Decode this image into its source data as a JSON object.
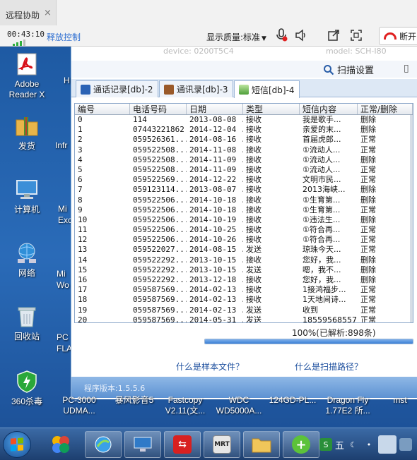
{
  "remote": {
    "title": "远程协助",
    "close_glyph": "×",
    "elapsed": "00:43:10",
    "release_control": "释放控制",
    "display_quality": "显示质量:标准",
    "disconnect": "断开"
  },
  "desktop": {
    "icons": [
      {
        "label": "Adobe Reader X",
        "icon": "pdf-icon"
      },
      {
        "label": "发货",
        "icon": "folder-icon"
      },
      {
        "label": "计算机",
        "icon": "computer-icon"
      },
      {
        "label": "网络",
        "icon": "network-icon"
      },
      {
        "label": "回收站",
        "icon": "recycle-bin-icon"
      },
      {
        "label": "360杀毒",
        "icon": "shield-icon"
      }
    ],
    "side_labels": [
      "H",
      "Infr",
      "Mi Exc",
      "Mi Wo",
      "PC FLA"
    ],
    "bottom_labels": [
      "PC-3000 UDMA...",
      "暴风影音5",
      "Fastcopy V2.11(文...",
      "WDC WD5000A...",
      "124GD-PL...",
      "Dragon Fly 1.77E2 所...",
      "mst"
    ]
  },
  "app": {
    "ghost_left": "device: 0200T5C4",
    "ghost_right": "model: SCH-I80",
    "scan_settings": "扫描设置",
    "tabs": [
      {
        "label": "通话记录[db]-2",
        "icon": "phone-icon"
      },
      {
        "label": "通讯录[db]-3",
        "icon": "contacts-icon"
      },
      {
        "label": "短信[db]-4",
        "icon": "sms-icon"
      }
    ],
    "columns": [
      "编号",
      "电话号码",
      "日期",
      "类型",
      "短信内容",
      "正常/删除"
    ],
    "rows": [
      [
        "0",
        "114",
        "2013-08-08 ...",
        "接收",
        "我是歌手...",
        "删除"
      ],
      [
        "1",
        "07443221862",
        "2014-12-04 ...",
        "接收",
        "亲爱的末...",
        "删除"
      ],
      [
        "2",
        "059526361...",
        "2014-08-16 ...",
        "接收",
        "首届虎郎...",
        "正常"
      ],
      [
        "3",
        "059522508...",
        "2014-11-08 ...",
        "接收",
        "①流动人...",
        "正常"
      ],
      [
        "4",
        "059522508...",
        "2014-11-09 ...",
        "接收",
        "①流动人...",
        "删除"
      ],
      [
        "5",
        "059522508...",
        "2014-11-09 ...",
        "接收",
        "①流动人...",
        "正常"
      ],
      [
        "6",
        "059522569...",
        "2014-12-22 ...",
        "接收",
        "文明市民...",
        "正常"
      ],
      [
        "7",
        "059123114...",
        "2013-08-07 ...",
        "接收",
        "2013海峡...",
        "删除"
      ],
      [
        "8",
        "059522506...",
        "2014-10-18 ...",
        "接收",
        "①生育第...",
        "删除"
      ],
      [
        "9",
        "059522506...",
        "2014-10-18 ...",
        "接收",
        "①生育第...",
        "正常"
      ],
      [
        "10",
        "059522506...",
        "2014-10-19 ...",
        "接收",
        "①违法生...",
        "删除"
      ],
      [
        "11",
        "059522506...",
        "2014-10-25 ...",
        "接收",
        "①符合再...",
        "正常"
      ],
      [
        "12",
        "059522506...",
        "2014-10-26 ...",
        "接收",
        "①符合再...",
        "正常"
      ],
      [
        "13",
        "059522027...",
        "2014-08-15 ...",
        "发送",
        "琼珠今天...",
        "正常"
      ],
      [
        "14",
        "059522292...",
        "2013-10-15 ...",
        "接收",
        "您好，我...",
        "删除"
      ],
      [
        "15",
        "059522292...",
        "2013-10-15 ...",
        "发送",
        "嗯，我不...",
        "删除"
      ],
      [
        "16",
        "059522292...",
        "2013-12-18 ...",
        "接收",
        "您好，我...",
        "删除"
      ],
      [
        "17",
        "059587569...",
        "2014-02-13 ...",
        "接收",
        "1接鸿福步...",
        "正常"
      ],
      [
        "18",
        "059587569...",
        "2014-02-13 ...",
        "接收",
        "1天地间诗...",
        "正常"
      ],
      [
        "19",
        "059587569...",
        "2014-02-13 ...",
        "发送",
        "收到",
        "正常"
      ],
      [
        "20",
        "059587569...",
        "2014-05-31 ...",
        "发送",
        "18559568557",
        "正常"
      ]
    ],
    "progress_text": "100%(已解析:898条)",
    "progress_fraction": 1.0,
    "help_sample": "什么是样本文件？",
    "help_path": "什么是扫描路径？",
    "version": "程序版本:1.5.5.6"
  },
  "taskbar": {
    "buttons": [
      "start-button",
      "app-button",
      "browser-button",
      "remote-button",
      "tool-button",
      "mrt-button",
      "explorer-button",
      "security-button",
      "tray-user-button"
    ],
    "tray_text": "五"
  }
}
